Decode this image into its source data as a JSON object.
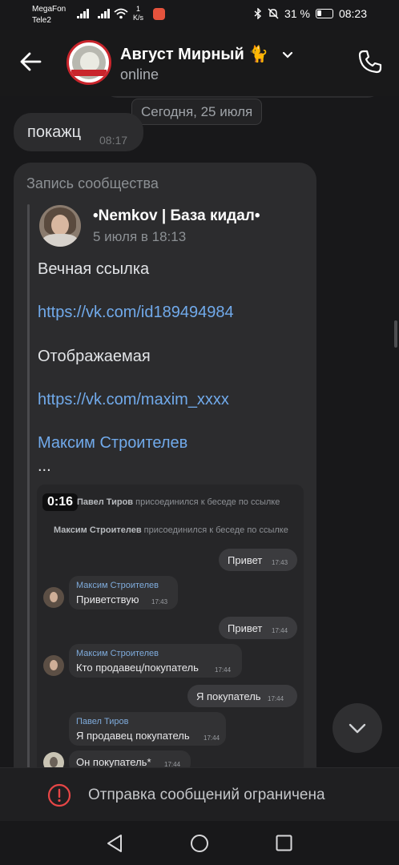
{
  "status_bar": {
    "carrier1": "MegaFon",
    "carrier2": "Tele2",
    "speed_value": "1",
    "speed_unit": "K/s",
    "battery": "31 %",
    "time": "08:23"
  },
  "header": {
    "title": "Август Мирный 🐈",
    "status": "online"
  },
  "chat": {
    "date_chip": "Сегодня, 25 июля",
    "msg1": {
      "text": "покажц",
      "time": "08:17"
    },
    "repost": {
      "label": "Запись сообщества",
      "author": "•Nemkov | База кидал•",
      "date": "5 июля в 18:13",
      "line1": "Вечная ссылка",
      "link1": "https://vk.com/id189494984",
      "line2": "Отображаемая",
      "link2": "https://vk.com/maxim_xxxx",
      "name_link": "Максим Строителев",
      "ellipsis": "...",
      "video": {
        "duration": "0:16",
        "sys1_name": "Павел Тиров",
        "sys1_text": "присоединился к беседе по ссылке",
        "sys2_name": "Максим Строителев",
        "sys2_text": "присоединился к беседе по ссылке",
        "m1": {
          "text": "Привет",
          "time": "17:43"
        },
        "m2": {
          "name": "Максим Строителев",
          "text": "Приветствую",
          "time": "17:43"
        },
        "m3": {
          "text": "Привет",
          "time": "17:44"
        },
        "m4": {
          "name": "Максим Строителев",
          "text": "Кто продавец/покупатель",
          "time": "17:44"
        },
        "m5": {
          "text": "Я покупатель",
          "time": "17:44"
        },
        "m6": {
          "name": "Павел Тиров",
          "text": "Я продавец покупатель",
          "time": "17:44"
        },
        "m7": {
          "text": "Он покупатель*",
          "time": "17:44"
        }
      }
    }
  },
  "footer": {
    "restriction_text": "Отправка сообщений ограничена"
  },
  "colors": {
    "background": "#18181a",
    "bubble": "#2c2c2e",
    "link": "#71aaeb",
    "warning": "#e64646"
  }
}
